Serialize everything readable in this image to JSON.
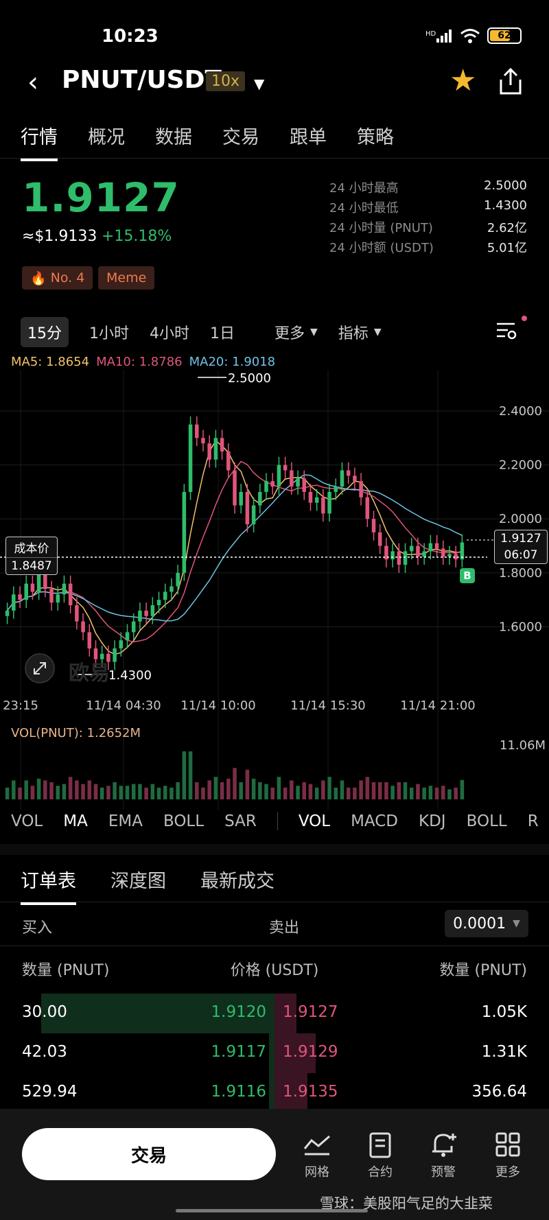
{
  "status_bar": {
    "time": "10:23",
    "battery": "62"
  },
  "header": {
    "pair": "PNUT/USDT",
    "leverage": "10x"
  },
  "tabs": [
    "行情",
    "概况",
    "数据",
    "交易",
    "跟单",
    "策略"
  ],
  "price": {
    "last": "1.9127",
    "usd": "≈$1.9133",
    "change": "+15.18%",
    "tags": [
      "No. 4",
      "Meme"
    ]
  },
  "stats": [
    {
      "label": "24 小时最高",
      "value": "2.5000"
    },
    {
      "label": "24 小时最低",
      "value": "1.4300"
    },
    {
      "label": "24 小时量 (PNUT)",
      "value": "2.62亿"
    },
    {
      "label": "24 小时额 (USDT)",
      "value": "5.01亿"
    }
  ],
  "intervals": {
    "i15": "15分",
    "i1h": "1小时",
    "i4h": "4小时",
    "i1d": "1日",
    "more": "更多",
    "indicator": "指标"
  },
  "ma_legend": {
    "ma5": "MA5: 1.8654",
    "ma10": "MA10: 1.8786",
    "ma20": "MA20: 1.9018"
  },
  "chart_data": {
    "type": "candlestick",
    "y_ticks": [
      "2.4000",
      "2.2000",
      "2.0000",
      "1.8000",
      "1.6000"
    ],
    "ylim": [
      1.38,
      2.55
    ],
    "x_ticks": [
      "23:15",
      "11/14 04:30",
      "11/14 10:00",
      "11/14 15:30",
      "11/14 21:00"
    ],
    "high_label": "2.5000",
    "low_label": "1.4300",
    "cost_label": "成本价",
    "cost_value": "1.8487",
    "current_price": "1.9127",
    "countdown": "06:07",
    "buy_marker": "B",
    "watermark": "欧易",
    "closes": [
      1.66,
      1.72,
      1.7,
      1.76,
      1.73,
      1.8,
      1.74,
      1.69,
      1.72,
      1.76,
      1.68,
      1.62,
      1.58,
      1.52,
      1.48,
      1.5,
      1.47,
      1.52,
      1.55,
      1.58,
      1.62,
      1.66,
      1.64,
      1.68,
      1.7,
      1.73,
      1.75,
      1.8,
      2.1,
      2.35,
      2.3,
      2.28,
      2.22,
      2.3,
      2.25,
      2.18,
      2.05,
      2.1,
      1.98,
      2.05,
      2.1,
      2.14,
      2.12,
      2.2,
      2.18,
      2.12,
      2.15,
      2.1,
      2.06,
      2.08,
      2.02,
      2.1,
      2.12,
      2.18,
      2.16,
      2.14,
      2.08,
      2.0,
      1.95,
      1.9,
      1.85,
      1.88,
      1.83,
      1.88,
      1.9,
      1.86,
      1.88,
      1.91,
      1.89,
      1.86,
      1.87,
      1.85,
      1.9127
    ],
    "volume_label": "VOL(PNUT): 1.2652M",
    "volume_max": "11.06M"
  },
  "indicators": [
    "VOL",
    "MA",
    "EMA",
    "BOLL",
    "SAR",
    "VOL",
    "MACD",
    "KDJ",
    "BOLL",
    "R"
  ],
  "orderbook": {
    "tabs": [
      "订单表",
      "深度图",
      "最新成交"
    ],
    "buy_label": "买入",
    "sell_label": "卖出",
    "precision": "0.0001",
    "headers": [
      "数量 (PNUT)",
      "价格 (USDT)",
      "数量 (PNUT)"
    ],
    "rows": [
      {
        "bid_qty": "30.00",
        "bid_price": "1.9120",
        "ask_price": "1.9127",
        "ask_qty": "1.05K",
        "bid_depth": 0.85,
        "ask_depth": 0.08
      },
      {
        "bid_qty": "42.03",
        "bid_price": "1.9117",
        "ask_price": "1.9129",
        "ask_qty": "1.31K",
        "bid_depth": 0.02,
        "ask_depth": 0.15
      },
      {
        "bid_qty": "529.94",
        "bid_price": "1.9116",
        "ask_price": "1.9135",
        "ask_qty": "356.64",
        "bid_depth": 0.02,
        "ask_depth": 0.12
      }
    ]
  },
  "bottom_nav": {
    "trade": "交易",
    "grid": "网格",
    "contract": "合约",
    "alert": "预警",
    "more": "更多"
  },
  "footer_watermark": "雪球：美股阳气足的大韭菜"
}
